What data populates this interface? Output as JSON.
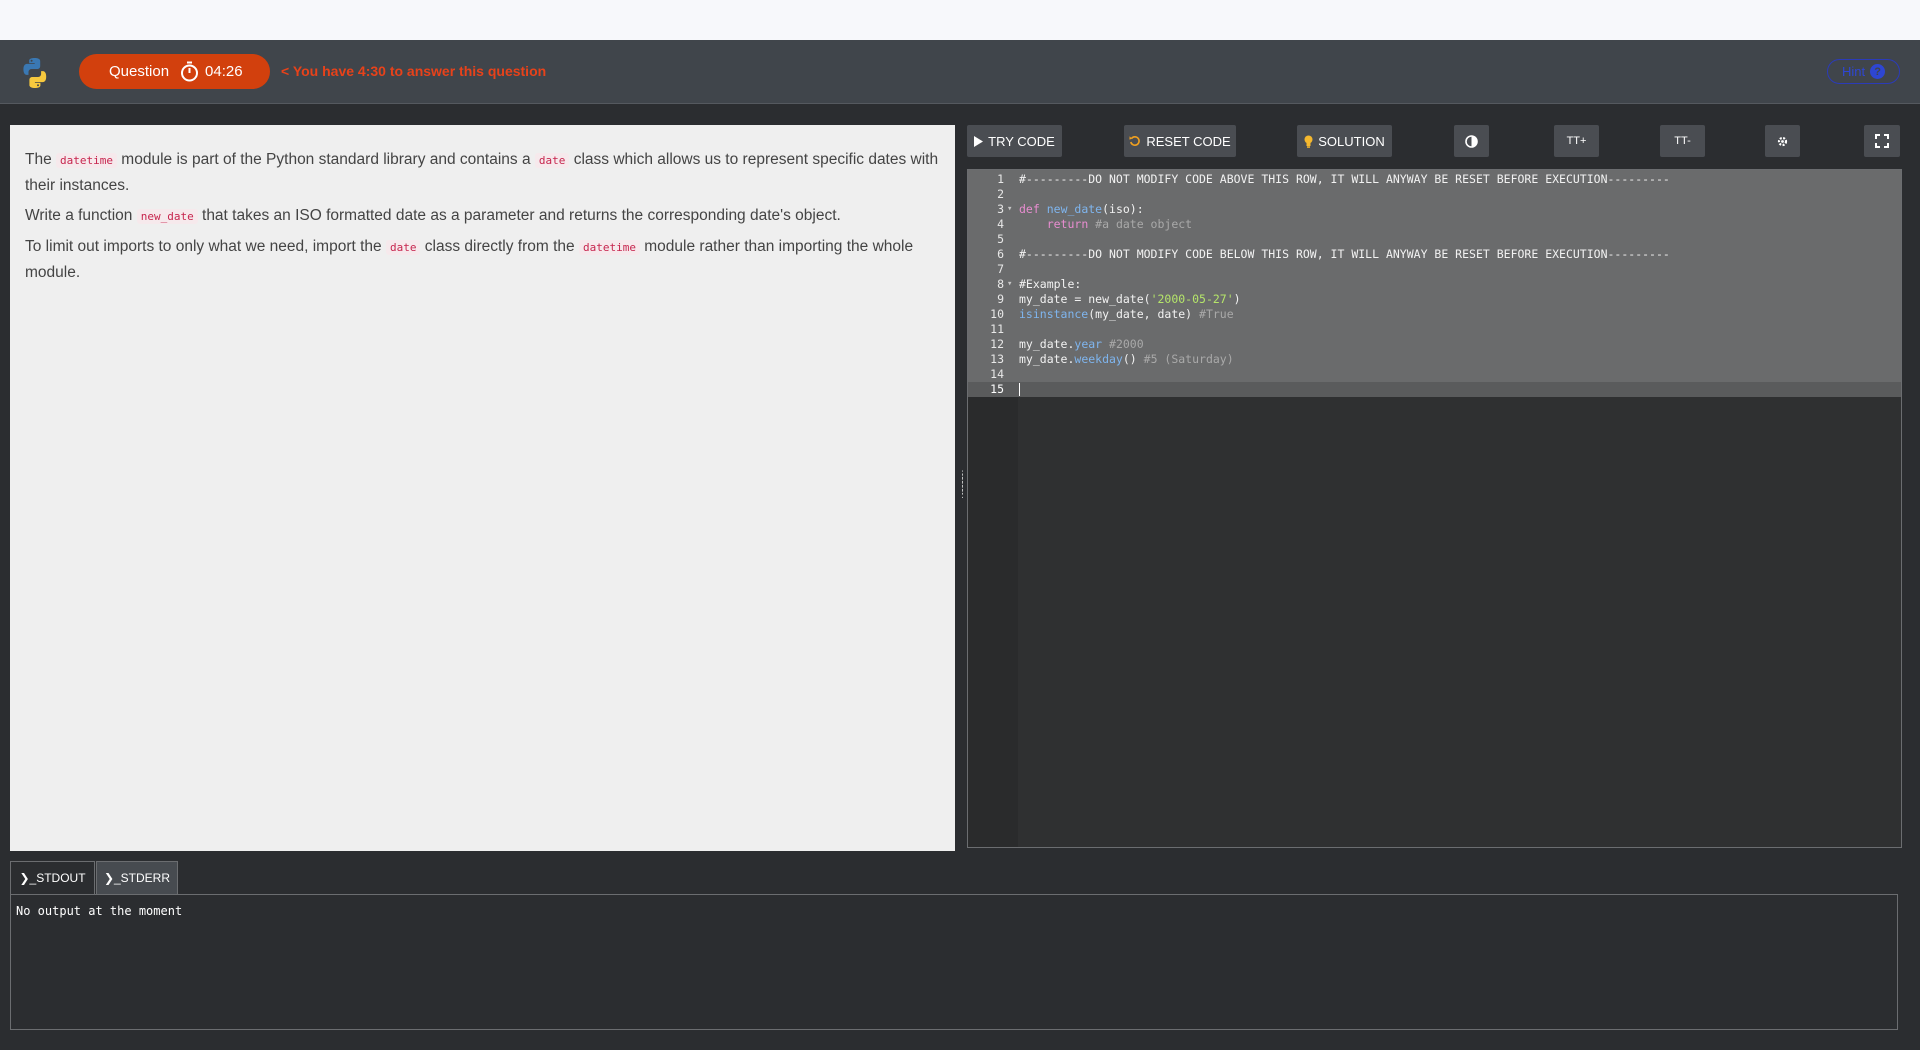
{
  "header": {
    "question_label": "Question",
    "timer": "04:26",
    "warning": "< You have 4:30 to answer this question",
    "hint_label": "Hint",
    "hint_icon": "?"
  },
  "question": {
    "p1": {
      "a": "The ",
      "code1": "datetime",
      "b": " module is part of the Python standard library and contains a ",
      "code2": "date",
      "c": " class which allows us to represent specific dates with their instances."
    },
    "p2": {
      "a": "Write a function ",
      "code1": "new_date",
      "b": " that takes an ISO formatted date as a parameter and returns the corresponding date's object."
    },
    "p3": {
      "a": "To limit out imports to only what we need, import the ",
      "code1": "date",
      "b": " class directly from the ",
      "code2": "datetime",
      "c": " module rather than importing the whole module."
    }
  },
  "toolbar": {
    "try_code": "TRY CODE",
    "reset_code": "RESET CODE",
    "solution": "SOLUTION",
    "font_increase": "TT+",
    "font_decrease": "TT-"
  },
  "editor": {
    "line_numbers": [
      "1",
      "2",
      "3",
      "4",
      "5",
      "6",
      "7",
      "8",
      "9",
      "10",
      "11",
      "12",
      "13",
      "14",
      "15"
    ],
    "l1": "#---------DO NOT MODIFY CODE ABOVE THIS ROW, IT WILL ANYWAY BE RESET BEFORE EXECUTION---------",
    "l3_kw": "def",
    "l3_fn": "new_date",
    "l3_rest": "(iso):",
    "l4_indent": "    ",
    "l4_kw": "return",
    "l4_cm": " #a date object",
    "l6": "#---------DO NOT MODIFY CODE BELOW THIS ROW, IT WILL ANYWAY BE RESET BEFORE EXECUTION---------",
    "l8": "#Example:",
    "l9_a": "my_date = new_date(",
    "l9_st": "'2000-05-27'",
    "l9_b": ")",
    "l10_fn": "isinstance",
    "l10_a": "(my_date, date) ",
    "l10_cm": "#True",
    "l12_a": "my_date.",
    "l12_pr": "year",
    "l12_cm": " #2000",
    "l13_a": "my_date.",
    "l13_pr": "weekday",
    "l13_b": "() ",
    "l13_cm": "#5 (Saturday)"
  },
  "output_tabs": {
    "stdout": "❯_STDOUT",
    "stderr": "❯_STDERR"
  },
  "output": {
    "text": "No output at the moment"
  },
  "colors": {
    "accent": "#d2400d",
    "warning_text": "#e8421a",
    "hint_blue": "#2e46d3",
    "header_bg": "#40454b"
  }
}
